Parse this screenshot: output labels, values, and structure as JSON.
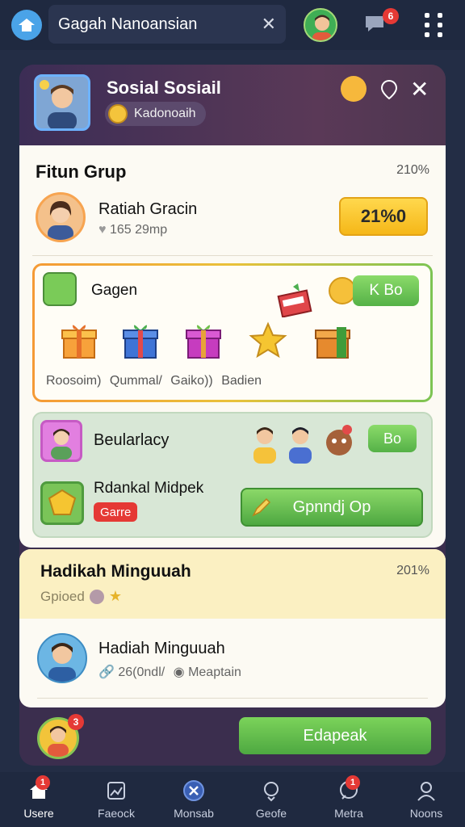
{
  "topbar": {
    "search_value": "Gagah Nanoansian",
    "badge": "6"
  },
  "panel": {
    "title": "Sosial Sosiail",
    "chip": "Kadonoaih"
  },
  "main": {
    "section_title": "Fitun Grup",
    "section_pct": "210%",
    "row_name": "Ratiah Gracin",
    "row_sub": "165 29mp",
    "row_button": "21%0"
  },
  "gift_box": {
    "title": "Gagen",
    "button": "K Bo",
    "labels": [
      "Roosoim)",
      "Qummal/",
      "Gaiko))",
      "Badien"
    ]
  },
  "green_card": {
    "title": "Beularlacy",
    "button": "Bo",
    "subtitle": "Rdankal Midpek",
    "tag": "Garre",
    "cta": "Gpnndj Op"
  },
  "weekly": {
    "title": "Hadikah Minguuah",
    "pct": "201%",
    "sub": "Gpioed",
    "name": "Hadiah Minguuah",
    "meta_1": "26(0ndl/",
    "meta_2": "Meaptain"
  },
  "bottom": {
    "badge": "3",
    "cta": "Edapeak"
  },
  "nav": [
    {
      "label": "Usere",
      "badge": "1"
    },
    {
      "label": "Faeock",
      "badge": ""
    },
    {
      "label": "Monsab",
      "badge": ""
    },
    {
      "label": "Geofe",
      "badge": ""
    },
    {
      "label": "Metra",
      "badge": "1"
    },
    {
      "label": "Noons",
      "badge": ""
    }
  ]
}
